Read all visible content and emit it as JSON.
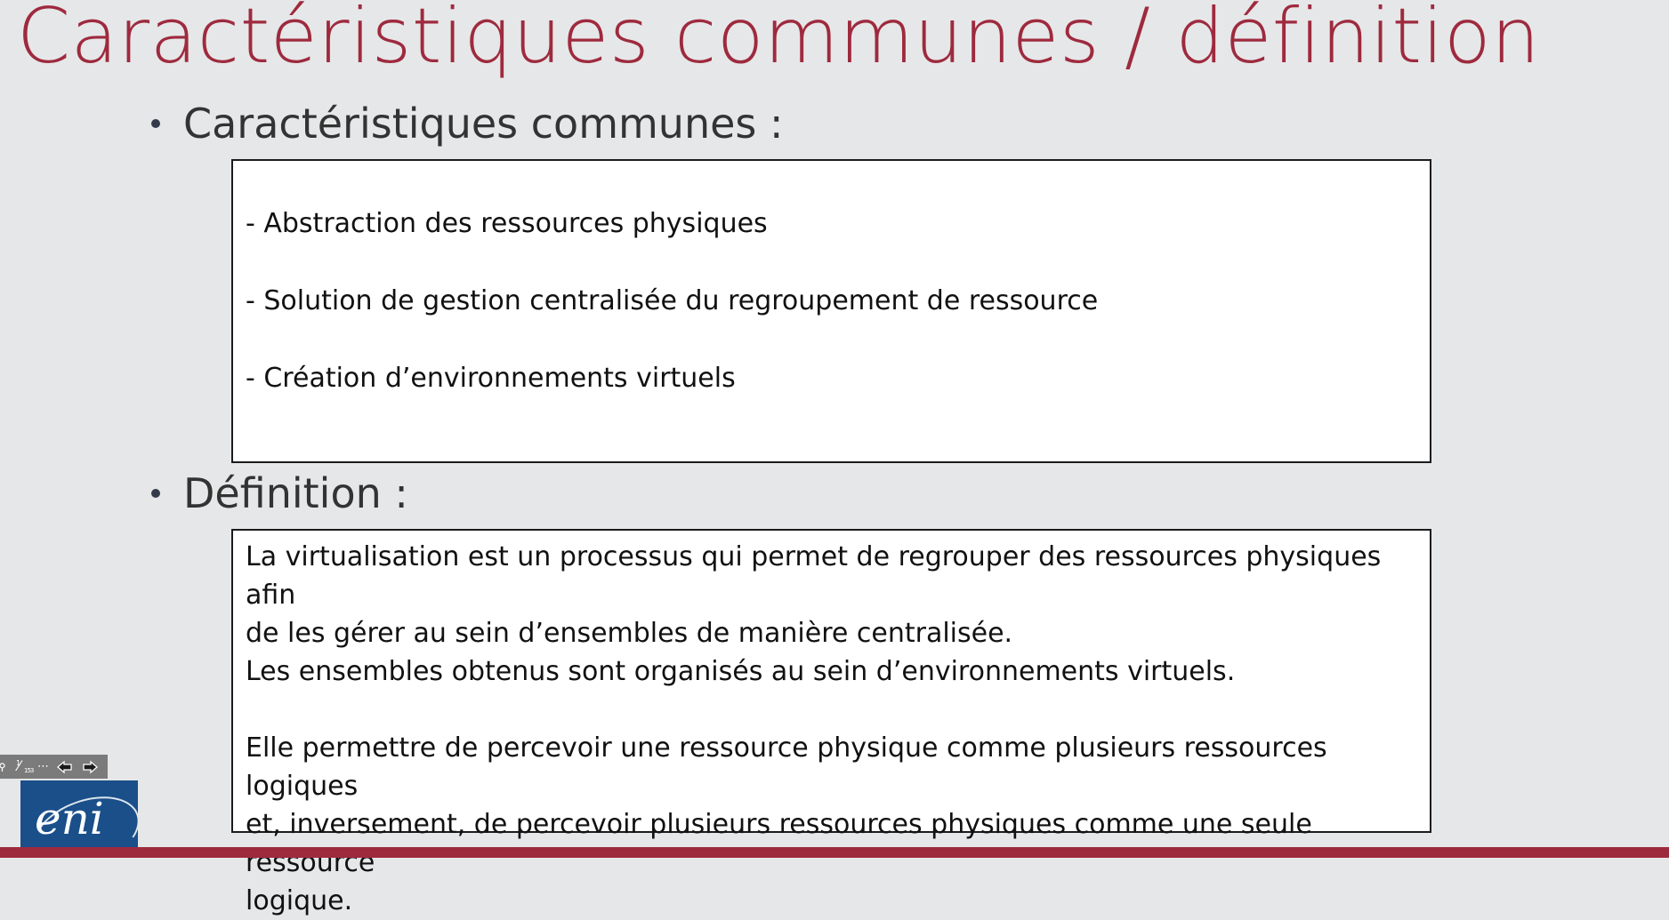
{
  "title": "Caractéristiques communes / définition",
  "section_1": {
    "heading": "Caractéristiques communes :",
    "items": [
      "- Abstraction des ressources physiques",
      "- Solution de gestion centralisée du regroupement de ressource",
      "- Création d’environnements virtuels"
    ]
  },
  "section_2": {
    "heading": "Définition :",
    "lines": [
      "La virtualisation est un processus qui permet de regrouper des ressources physiques afin",
      "de les gérer au sein d’ensembles de manière centralisée.",
      "Les ensembles obtenus sont organisés au sein d’environnements virtuels.",
      "Elle permettre de percevoir une ressource physique comme plusieurs ressources logiques",
      "et, inversement, de percevoir plusieurs ressources physiques comme une seule ressource",
      "logique."
    ]
  },
  "toolbar": {
    "page_current": "1",
    "page_total": "153",
    "more_label": "⋯"
  },
  "logo": {
    "text": "eni"
  },
  "colors": {
    "title": "#9e2a3e",
    "background": "#e6e7e8",
    "bottom_bar": "#9e2a3e",
    "logo_bg": "#1a4f8a",
    "toolbar_bg": "#7b7b7b"
  },
  "icons": {
    "pen": "pen-icon",
    "page": "page-counter-icon",
    "more": "more-icon",
    "prev": "arrow-left-icon",
    "next": "arrow-right-icon"
  }
}
